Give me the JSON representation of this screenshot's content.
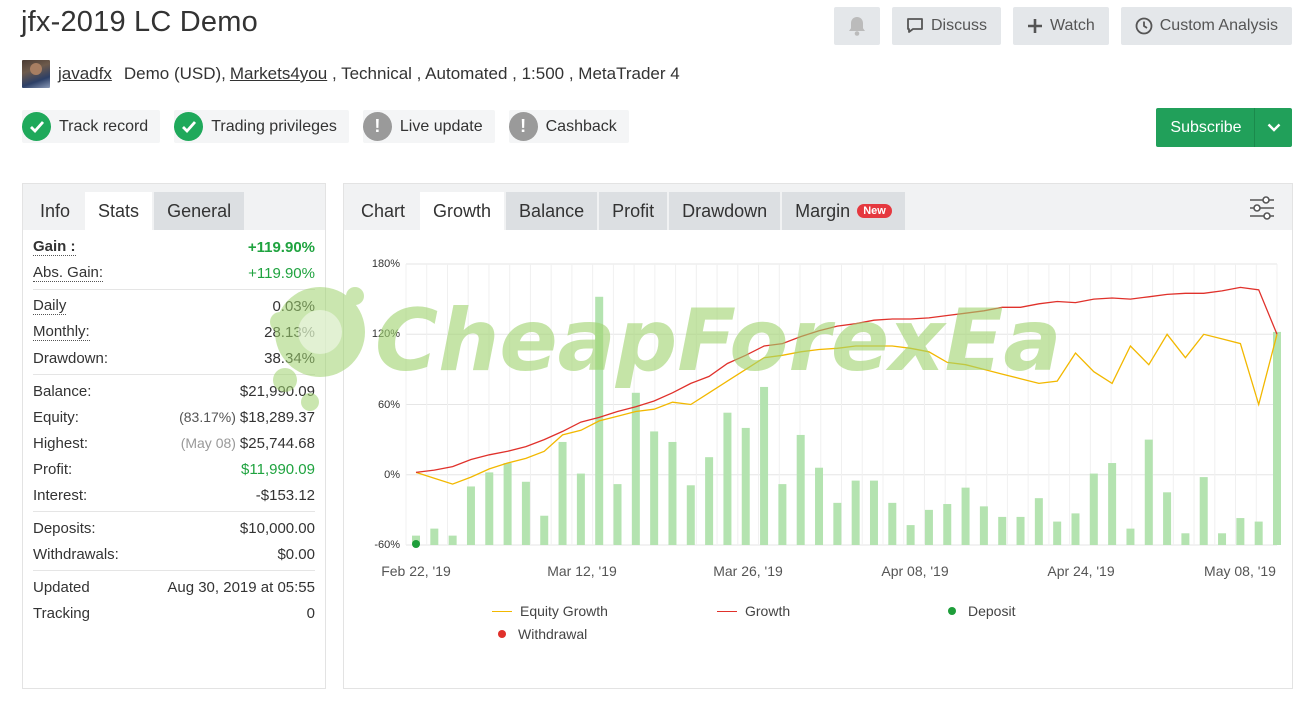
{
  "header": {
    "title": "jfx-2019 LC Demo",
    "buttons": {
      "discuss": "Discuss",
      "watch": "Watch",
      "custom_analysis": "Custom Analysis"
    }
  },
  "meta": {
    "user": "javadfx",
    "account_type": "Demo (USD),",
    "broker": "Markets4you",
    "rest": " , Technical , Automated , 1:500 , MetaTrader 4"
  },
  "badges": [
    {
      "label": "Track record",
      "status": "ok"
    },
    {
      "label": "Trading privileges",
      "status": "ok"
    },
    {
      "label": "Live update",
      "status": "warn"
    },
    {
      "label": "Cashback",
      "status": "warn"
    }
  ],
  "subscribe_label": "Subscribe",
  "stats_tabs": [
    "Info",
    "Stats",
    "General"
  ],
  "stats": {
    "gain_label": "Gain :",
    "gain": "+119.90%",
    "abs_gain_label": "Abs. Gain:",
    "abs_gain": "+119.90%",
    "daily_label": "Daily",
    "daily": "0.03%",
    "monthly_label": "Monthly:",
    "monthly": "28.13%",
    "drawdown_label": "Drawdown:",
    "drawdown": "38.34%",
    "balance_label": "Balance:",
    "balance": "$21,990.09",
    "equity_label": "Equity:",
    "equity_pct": "(83.17%)",
    "equity": "$18,289.37",
    "highest_label": "Highest:",
    "highest_date": "(May 08)",
    "highest": "$25,744.68",
    "profit_label": "Profit:",
    "profit": "$11,990.09",
    "interest_label": "Interest:",
    "interest": "-$153.12",
    "deposits_label": "Deposits:",
    "deposits": "$10,000.00",
    "withdrawals_label": "Withdrawals:",
    "withdrawals": "$0.00",
    "updated_label": "Updated",
    "updated": "Aug 30, 2019 at 05:55",
    "tracking_label": "Tracking",
    "tracking": "0"
  },
  "chart_tabs": {
    "chart": "Chart",
    "growth": "Growth",
    "balance": "Balance",
    "profit": "Profit",
    "drawdown": "Drawdown",
    "margin": "Margin",
    "margin_badge": "New"
  },
  "watermark": "CheapForexEa",
  "colors": {
    "equity": "#f2b800",
    "growth": "#e0312b",
    "deposit": "#1e9e3a",
    "withdrawal": "#e0312b",
    "bars": "#b4e3b0",
    "primary_green": "#21a05a"
  },
  "chart_data": {
    "type": "bar+line",
    "y_ticks": [
      "180%",
      "120%",
      "60%",
      "0%",
      "-60%"
    ],
    "ylim": [
      -60,
      180
    ],
    "x_ticks": [
      "Feb 22, '19",
      "Mar 12, '19",
      "Mar 26, '19",
      "Apr 08, '19",
      "Apr 24, '19",
      "May 08, '19"
    ],
    "legend": [
      "Equity Growth",
      "Growth",
      "Deposit",
      "Withdrawal"
    ],
    "bars": [
      -52,
      -46,
      -52,
      -10,
      2,
      10,
      -6,
      -35,
      28,
      1,
      152,
      -8,
      70,
      37,
      28,
      -9,
      15,
      53,
      40,
      75,
      -8,
      34,
      6,
      -24,
      -5,
      -5,
      -24,
      -43,
      -30,
      -25,
      -11,
      -27,
      -36,
      -36,
      -20,
      -40,
      -33,
      1,
      10,
      -46,
      30,
      -15,
      -50,
      -2,
      -50,
      -37,
      -40,
      122
    ],
    "growth": [
      2,
      4,
      7,
      13,
      17,
      20,
      24,
      30,
      37,
      45,
      49,
      54,
      58,
      63,
      70,
      78,
      84,
      95,
      102,
      110,
      112,
      118,
      123,
      127,
      129,
      132,
      133,
      133,
      134,
      136,
      138,
      140,
      143,
      143,
      146,
      148,
      147,
      150,
      151,
      150,
      152,
      154,
      155,
      155,
      157,
      160,
      158,
      120
    ],
    "equity_growth": [
      2,
      -3,
      -8,
      -2,
      5,
      10,
      14,
      20,
      34,
      38,
      46,
      50,
      54,
      56,
      62,
      60,
      70,
      80,
      90,
      100,
      102,
      105,
      107,
      108,
      110,
      110,
      110,
      108,
      105,
      96,
      94,
      90,
      86,
      82,
      78,
      80,
      104,
      88,
      78,
      110,
      94,
      120,
      100,
      120,
      116,
      112,
      60,
      120
    ],
    "deposit_points": [
      -60
    ],
    "withdrawal_points": []
  }
}
